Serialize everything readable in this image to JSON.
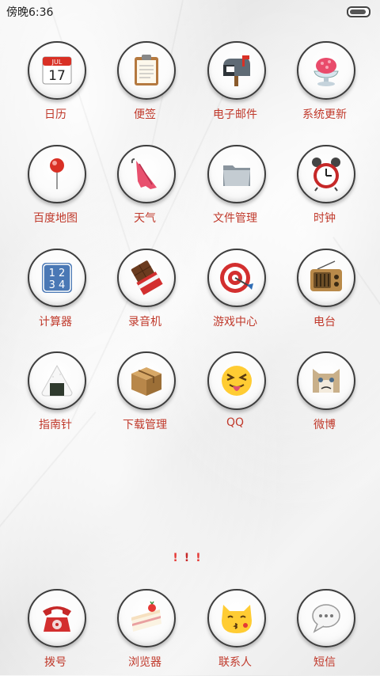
{
  "status_bar": {
    "time": "傍晚6:36"
  },
  "apps": [
    {
      "label": "日历",
      "icon": "calendar-icon"
    },
    {
      "label": "便签",
      "icon": "clipboard-icon"
    },
    {
      "label": "电子邮件",
      "icon": "mailbox-icon"
    },
    {
      "label": "系统更新",
      "icon": "shaved-ice-icon"
    },
    {
      "label": "百度地图",
      "icon": "pushpin-icon"
    },
    {
      "label": "天气",
      "icon": "umbrella-icon"
    },
    {
      "label": "文件管理",
      "icon": "folder-icon"
    },
    {
      "label": "时钟",
      "icon": "alarm-clock-icon"
    },
    {
      "label": "计算器",
      "icon": "numbers-icon"
    },
    {
      "label": "录音机",
      "icon": "chocolate-icon"
    },
    {
      "label": "游戏中心",
      "icon": "dart-target-icon"
    },
    {
      "label": "电台",
      "icon": "radio-icon"
    },
    {
      "label": "指南针",
      "icon": "rice-ball-icon"
    },
    {
      "label": "下载管理",
      "icon": "package-icon"
    },
    {
      "label": "QQ",
      "icon": "tongue-face-icon"
    },
    {
      "label": "微博",
      "icon": "grumpy-cat-icon"
    }
  ],
  "page_indicator": {
    "dots": [
      "!",
      "!",
      "!"
    ],
    "active_index": 1
  },
  "dock": [
    {
      "label": "拨号",
      "icon": "telephone-icon"
    },
    {
      "label": "浏览器",
      "icon": "cake-icon"
    },
    {
      "label": "联系人",
      "icon": "kissing-cat-icon"
    },
    {
      "label": "短信",
      "icon": "speech-bubble-icon"
    }
  ],
  "calendar_icon": {
    "month": "JUL",
    "day": "17"
  },
  "calculator_icon": {
    "digits": "1234"
  }
}
